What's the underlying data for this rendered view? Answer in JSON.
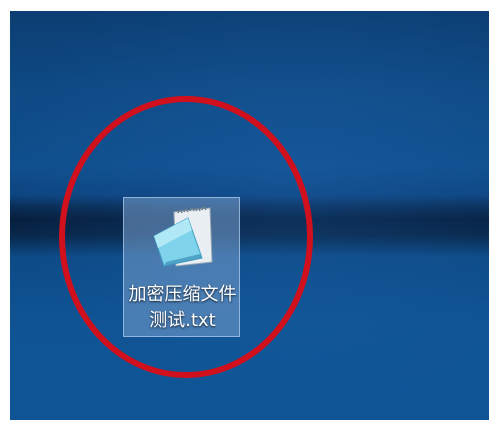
{
  "desktop": {
    "file": {
      "name_line1": "加密压缩文件",
      "name_line2": "测试.txt",
      "icon": "notepad-text-file-icon",
      "selected": true
    },
    "annotation": {
      "type": "circle",
      "color": "#d0101c"
    }
  }
}
